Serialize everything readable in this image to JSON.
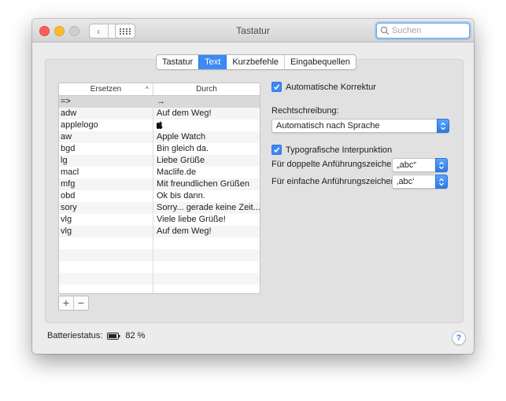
{
  "window": {
    "title": "Tastatur",
    "search_placeholder": "Suchen"
  },
  "tabs": [
    {
      "label": "Tastatur",
      "active": false
    },
    {
      "label": "Text",
      "active": true
    },
    {
      "label": "Kurzbefehle",
      "active": false
    },
    {
      "label": "Eingabequellen",
      "active": false
    }
  ],
  "table": {
    "headers": {
      "replace": "Ersetzen",
      "with": "Durch"
    },
    "sort_indicator": "^",
    "rows": [
      {
        "replace": "=>",
        "with": "→",
        "selected": true
      },
      {
        "replace": "adw",
        "with": "Auf dem Weg!"
      },
      {
        "replace": "applelogo",
        "with": "",
        "icon": "apple-logo-icon"
      },
      {
        "replace": "aw",
        "with": "Apple Watch"
      },
      {
        "replace": "bgd",
        "with": "Bin gleich da."
      },
      {
        "replace": "lg",
        "with": "Liebe Grüße"
      },
      {
        "replace": "macl",
        "with": "Maclife.de"
      },
      {
        "replace": "mfg",
        "with": "Mit freundlichen Grüßen"
      },
      {
        "replace": "obd",
        "with": "Ok bis dann."
      },
      {
        "replace": "sory",
        "with": "Sorry... gerade keine Zeit......"
      },
      {
        "replace": "vlg",
        "with": "Viele liebe Grüße!"
      },
      {
        "replace": "vlg",
        "with": "Auf dem Weg!"
      }
    ],
    "add_label": "+",
    "remove_label": "−"
  },
  "options": {
    "autocorrect": {
      "label": "Automatische Korrektur",
      "checked": true
    },
    "spelling_label": "Rechtschreibung:",
    "spelling_value": "Automatisch nach Sprache",
    "smart_punct": {
      "label": "Typografische Interpunktion",
      "checked": true
    },
    "double_quotes": {
      "label": "Für doppelte Anführungszeichen",
      "value": "„abc“"
    },
    "single_quotes": {
      "label": "Für einfache Anführungszeichen",
      "value": "‚abc‘"
    }
  },
  "battery": {
    "label": "Batteriestatus:",
    "value": "82 %"
  },
  "help_label": "?",
  "colors": {
    "accent": "#3b8af5",
    "close": "#fc5f57",
    "minimize": "#fdbc2e"
  }
}
